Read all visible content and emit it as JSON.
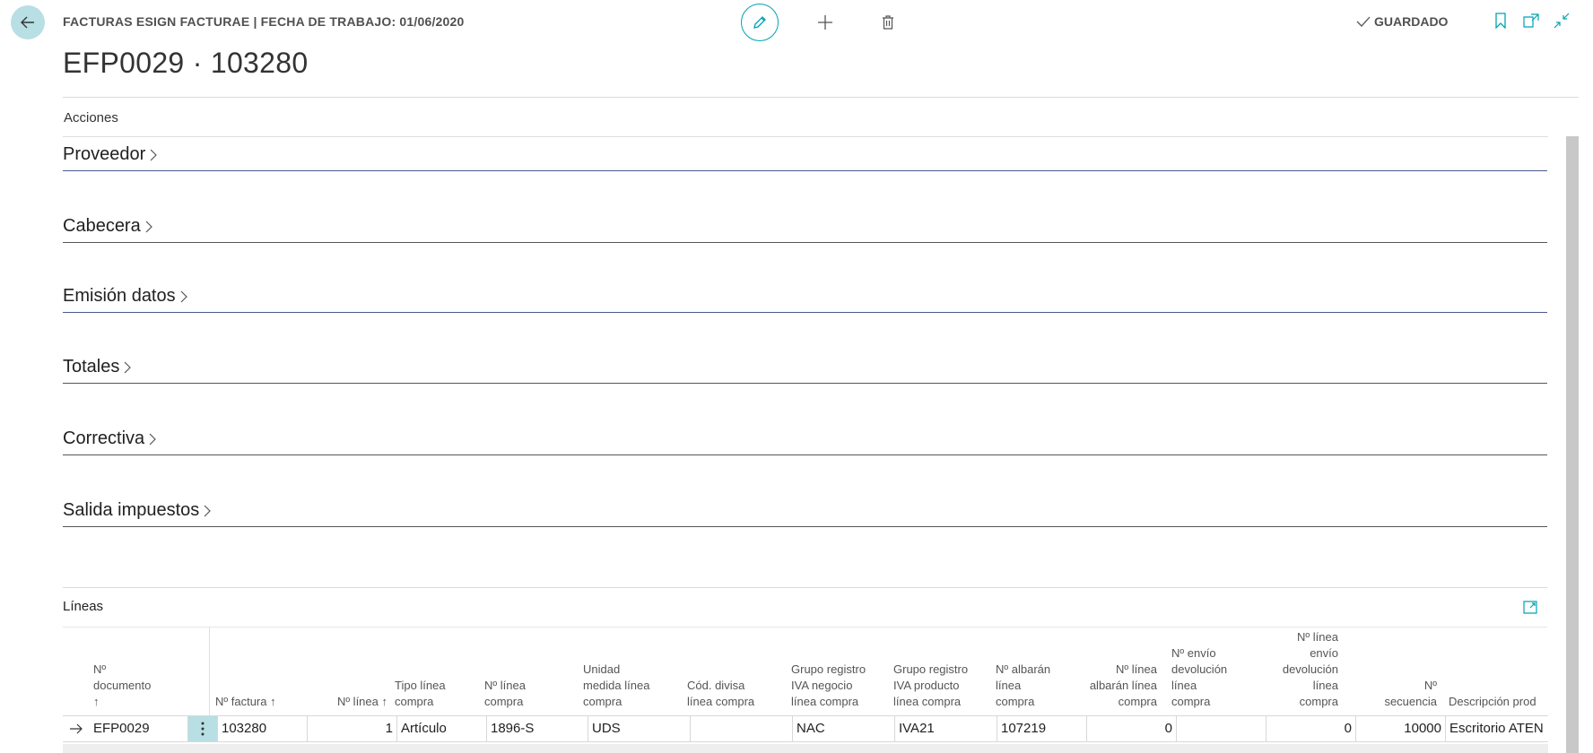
{
  "header": {
    "breadcrumb": "FACTURAS ESIGN FACTURAE | FECHA DE TRABAJO: 01/06/2020",
    "saved_status": "GUARDADO",
    "page_title": "EFP0029 · 103280"
  },
  "icons": {
    "back": "arrow-left-icon",
    "edit": "pencil-icon",
    "new": "plus-icon",
    "delete": "trash-icon",
    "saved": "check-icon",
    "bookmark": "bookmark-icon",
    "open_new": "open-in-new-window-icon",
    "collapse": "collapse-icon"
  },
  "colors": {
    "accent": "#00a3b4",
    "accent_bg": "#b7dfe4"
  },
  "menu": {
    "actions_label": "Acciones"
  },
  "fasttabs": [
    {
      "label": "Proveedor"
    },
    {
      "label": "Cabecera"
    },
    {
      "label": "Emisión datos"
    },
    {
      "label": "Totales"
    },
    {
      "label": "Correctiva"
    },
    {
      "label": "Salida impuestos"
    }
  ],
  "lines": {
    "title": "Líneas",
    "columns": [
      [
        "Nº",
        "documento",
        "↑"
      ],
      [
        "Nº factura ↑"
      ],
      [
        "Nº línea ↑"
      ],
      [
        "Tipo línea",
        "compra"
      ],
      [
        "Nº línea",
        "compra"
      ],
      [
        "Unidad",
        "medida línea",
        "compra"
      ],
      [
        "Cód. divisa",
        "línea compra"
      ],
      [
        "Grupo registro",
        "IVA negocio",
        "línea compra"
      ],
      [
        "Grupo registro",
        "IVA producto",
        "línea compra"
      ],
      [
        "Nº albarán",
        "línea",
        "compra"
      ],
      [
        "Nº línea",
        "albarán línea",
        "compra"
      ],
      [
        "Nº envío",
        "devolución",
        "línea",
        "compra"
      ],
      [
        "Nº línea",
        "envío",
        "devolución",
        "línea",
        "compra"
      ],
      [
        "Nº",
        "secuencia"
      ],
      [
        "Descripción prod"
      ]
    ],
    "row": {
      "documento": "EFP0029",
      "factura": "103280",
      "linea": "1",
      "tipo_linea": "Artículo",
      "num_linea_compra": "1896-S",
      "unidad_medida": "UDS",
      "cod_divisa": "",
      "grupo_iva_negocio": "NAC",
      "grupo_iva_producto": "IVA21",
      "num_albaran": "107219",
      "num_linea_albaran": "0",
      "num_envio_devolucion": "",
      "num_linea_envio_devolucion": "0",
      "num_secuencia": "10000",
      "descripcion": "Escritorio ATEN"
    }
  }
}
